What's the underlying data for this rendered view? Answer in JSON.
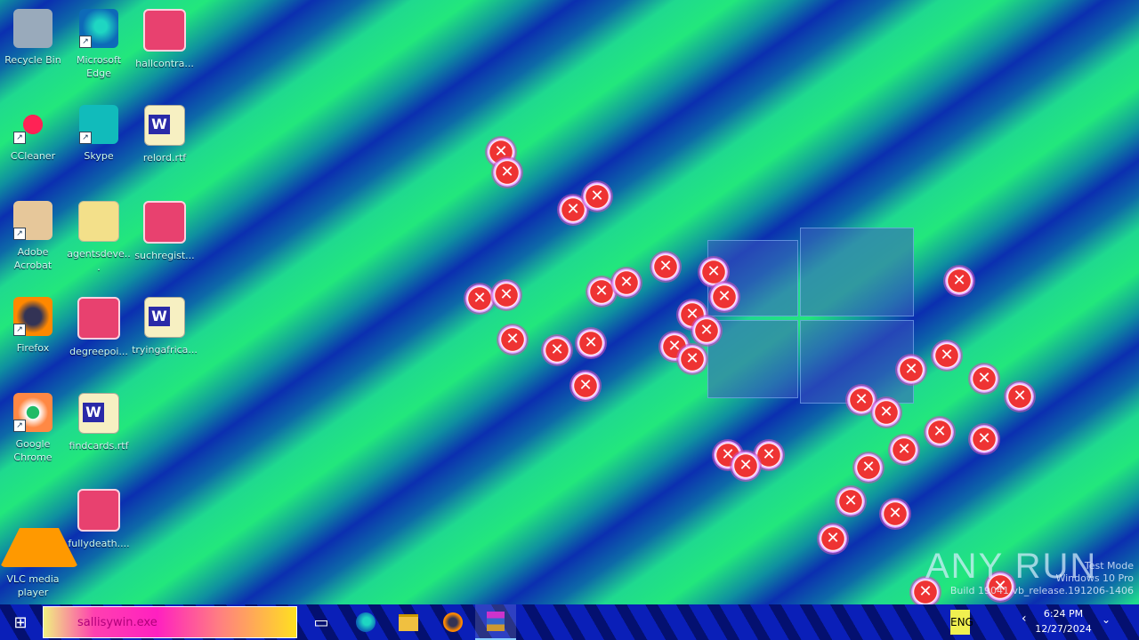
{
  "desktop": {
    "icons": [
      {
        "label": "Recycle Bin",
        "kind": "app-recycle"
      },
      {
        "label": "Microsoft Edge",
        "kind": "app-edge"
      },
      {
        "label": "hallcontra...",
        "kind": "file-img"
      },
      {
        "label": "CCleaner",
        "kind": "app-ccleaner"
      },
      {
        "label": "Skype",
        "kind": "app-skype"
      },
      {
        "label": "relord.rtf",
        "kind": "file-doc"
      },
      {
        "label": "Adobe Acrobat",
        "kind": "app-acrobat"
      },
      {
        "label": "agentsdeve...",
        "kind": "file-yellow"
      },
      {
        "label": "suchregist...",
        "kind": "file-img"
      },
      {
        "label": "Firefox",
        "kind": "app-firefox"
      },
      {
        "label": "degreepoi...",
        "kind": "file-img"
      },
      {
        "label": "tryingafrica...",
        "kind": "file-doc"
      },
      {
        "label": "Google Chrome",
        "kind": "app-chrome"
      },
      {
        "label": "findcards.rtf",
        "kind": "file-doc"
      },
      {
        "label": "VLC media player",
        "kind": "app-vlc"
      },
      {
        "label": "fullydeath....",
        "kind": "file-img"
      }
    ]
  },
  "watermark": "ANY RUN",
  "os_text": {
    "line1": "Test Mode",
    "line2": "Windows 10 Pro",
    "line3": "Build 19041.vb_release.191206-1406"
  },
  "taskbar": {
    "search_text": "sallisywin.exe",
    "lang": "ENG",
    "time": "6:24 PM",
    "date": "12/27/2024"
  },
  "icons_meta": {
    "start": "windows-start-icon",
    "task_view": "task-view-icon",
    "error": "error-x-icon"
  }
}
